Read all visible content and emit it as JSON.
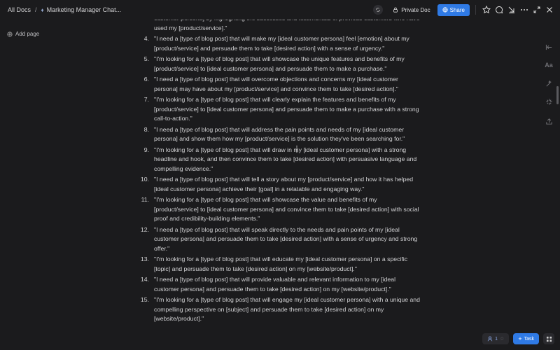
{
  "breadcrumb": {
    "root": "All Docs",
    "separator": "/",
    "doc_title": "Marketing Manager Chat..."
  },
  "toolbar": {
    "private_label": "Private Doc",
    "share_label": "Share"
  },
  "sidebar": {
    "add_page_label": "Add page"
  },
  "document": {
    "items": [
      {
        "num": "",
        "text": "customer persona] by highlighting the successes and testimonials of previous customers who have used my [product/service].\""
      },
      {
        "num": "4.",
        "text": "\"I need a [type of blog post] that will make my [ideal customer persona] feel [emotion] about my [product/service] and persuade them to take [desired action] with a sense of urgency.\""
      },
      {
        "num": "5.",
        "text": "\"I'm looking for a [type of blog post] that will showcase the unique features and benefits of my [product/service] to [ideal customer persona] and persuade them to make a purchase.\""
      },
      {
        "num": "6.",
        "text": "\"I need a [type of blog post] that will overcome objections and concerns my [ideal customer persona] may have about my [product/service] and convince them to take [desired action].\""
      },
      {
        "num": "7.",
        "text": "\"I'm looking for a [type of blog post] that will clearly explain the features and benefits of my [product/service] to [ideal customer persona] and persuade them to make a purchase with a strong call-to-action.\""
      },
      {
        "num": "8.",
        "text": "\"I need a [type of blog post] that will address the pain points and needs of my [ideal customer persona] and show them how my [product/service] is the solution they've been searching for.\""
      },
      {
        "num": "9.",
        "text": "\"I'm looking for a [type of blog post] that will draw in my [ideal customer persona] with a strong headline and hook, and then convince them to take [desired action] with persuasive language and compelling evidence.\""
      },
      {
        "num": "10.",
        "text": "\"I need a [type of blog post] that will tell a story about my [product/service] and how it has helped [ideal customer persona] achieve their [goal] in a relatable and engaging way.\""
      },
      {
        "num": "11.",
        "text": "\"I'm looking for a [type of blog post] that will showcase the value and benefits of my [product/service] to [ideal customer persona] and convince them to take [desired action] with social proof and credibility-building elements.\""
      },
      {
        "num": "12.",
        "text": "\"I need a [type of blog post] that will speak directly to the needs and pain points of my [ideal customer persona] and persuade them to take [desired action] with a sense of urgency and strong offer.\""
      },
      {
        "num": "13.",
        "text": "\"I'm looking for a [type of blog post] that will educate my [ideal customer persona] on a specific [topic] and persuade them to take [desired action] on my [website/product].\""
      },
      {
        "num": "14.",
        "text": "\"I need a [type of blog post] that will provide valuable and relevant information to my [ideal customer persona] and persuade them to take [desired action] on my [website/product].\""
      },
      {
        "num": "15.",
        "text": "\"I'm looking for a [type of blog post] that will engage my [ideal customer persona] with a unique and compelling perspective on [subject] and persuade them to take [desired action] on my [website/product].\""
      }
    ]
  },
  "rightbar": {
    "font_label": "Aa"
  },
  "bottom": {
    "user_count": "1",
    "task_label": "Task"
  },
  "colors": {
    "background": "#1b1b1d",
    "accent": "#2f7ae5",
    "text": "#d2d2d4"
  }
}
